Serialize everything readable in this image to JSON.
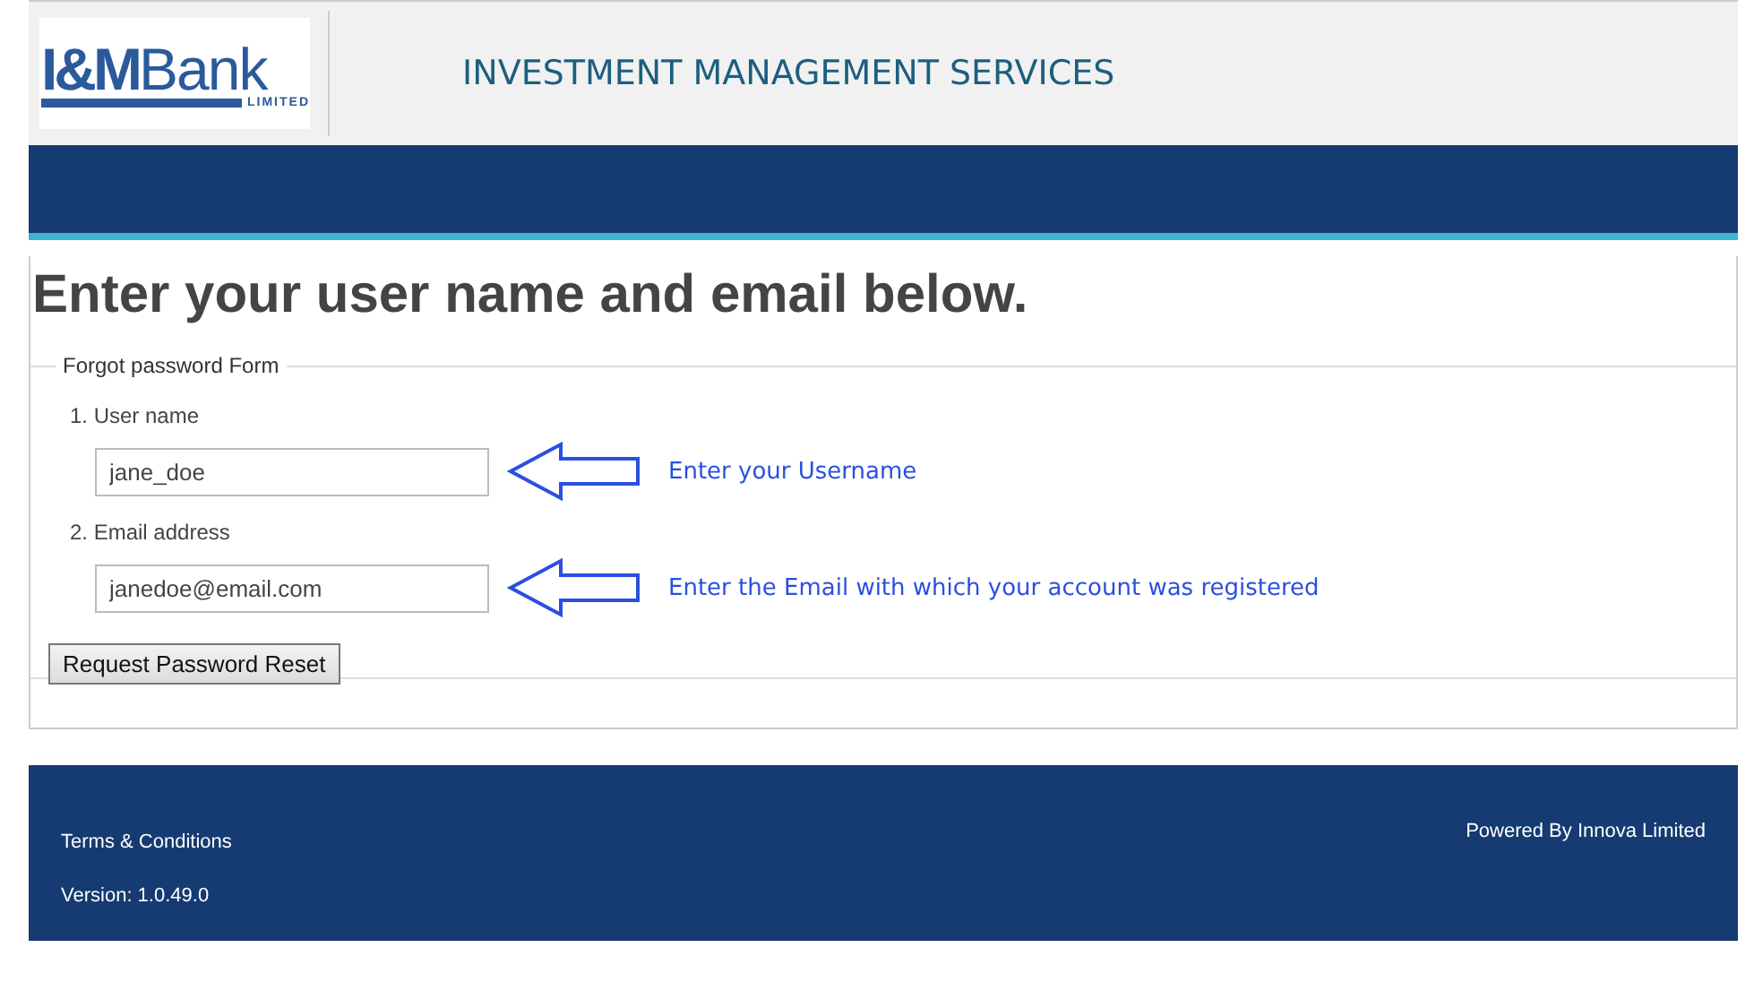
{
  "header": {
    "logo": {
      "mark": "I&M",
      "name": "Bank",
      "suffix": "LIMITED"
    },
    "title": "INVESTMENT MANAGEMENT SERVICES"
  },
  "heading": "Enter your user name and email below.",
  "form": {
    "legend": "Forgot password Form",
    "fields": [
      {
        "label": "1. User name",
        "value": "jane_doe",
        "annotation": "Enter your Username"
      },
      {
        "label": "2. Email address",
        "value": "janedoe@email.com",
        "annotation": "Enter the Email with which your account was registered"
      }
    ],
    "button": "Request Password Reset"
  },
  "footer": {
    "links": [
      "Terms & Conditions"
    ],
    "version": "Version: 1.0.49.0",
    "powered_by": "Powered By Innova Limited"
  }
}
